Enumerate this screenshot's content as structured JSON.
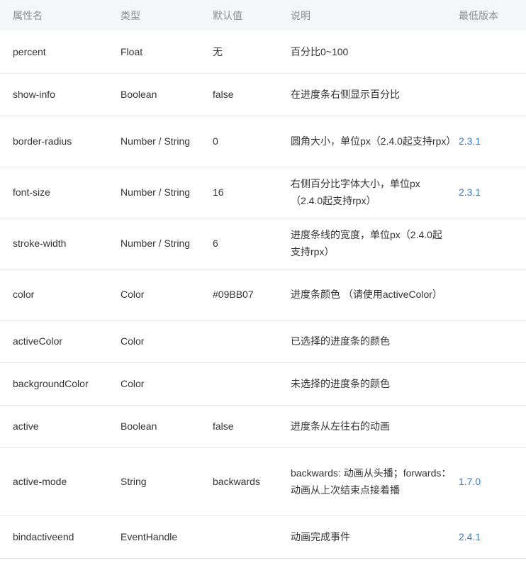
{
  "headers": [
    "属性名",
    "类型",
    "默认值",
    "说明",
    "最低版本"
  ],
  "rows": [
    {
      "name": "percent",
      "type": "Float",
      "default": "无",
      "desc": "百分比0~100",
      "version": ""
    },
    {
      "name": "show-info",
      "type": "Boolean",
      "default": "false",
      "desc": "在进度条右侧显示百分比",
      "version": ""
    },
    {
      "name": "border-radius",
      "type": "Number / String",
      "default": "0",
      "desc": "圆角大小，单位px（2.4.0起支持rpx）",
      "version": "2.3.1"
    },
    {
      "name": "font-size",
      "type": "Number / String",
      "default": "16",
      "desc": "右侧百分比字体大小，单位px（2.4.0起支持rpx）",
      "version": "2.3.1"
    },
    {
      "name": "stroke-width",
      "type": "Number / String",
      "default": "6",
      "desc": "进度条线的宽度，单位px（2.4.0起支持rpx）",
      "version": ""
    },
    {
      "name": "color",
      "type": "Color",
      "default": "#09BB07",
      "desc": "进度条颜色 （请使用activeColor）",
      "version": ""
    },
    {
      "name": "activeColor",
      "type": "Color",
      "default": "",
      "desc": "已选择的进度条的颜色",
      "version": ""
    },
    {
      "name": "backgroundColor",
      "type": "Color",
      "default": "",
      "desc": "未选择的进度条的颜色",
      "version": ""
    },
    {
      "name": "active",
      "type": "Boolean",
      "default": "false",
      "desc": "进度条从左往右的动画",
      "version": ""
    },
    {
      "name": "active-mode",
      "type": "String",
      "default": "backwards",
      "desc": "backwards: 动画从头播；forwards：动画从上次结束点接着播",
      "version": "1.7.0"
    },
    {
      "name": "bindactiveend",
      "type": "EventHandle",
      "default": "",
      "desc": "动画完成事件",
      "version": "2.4.1"
    }
  ]
}
